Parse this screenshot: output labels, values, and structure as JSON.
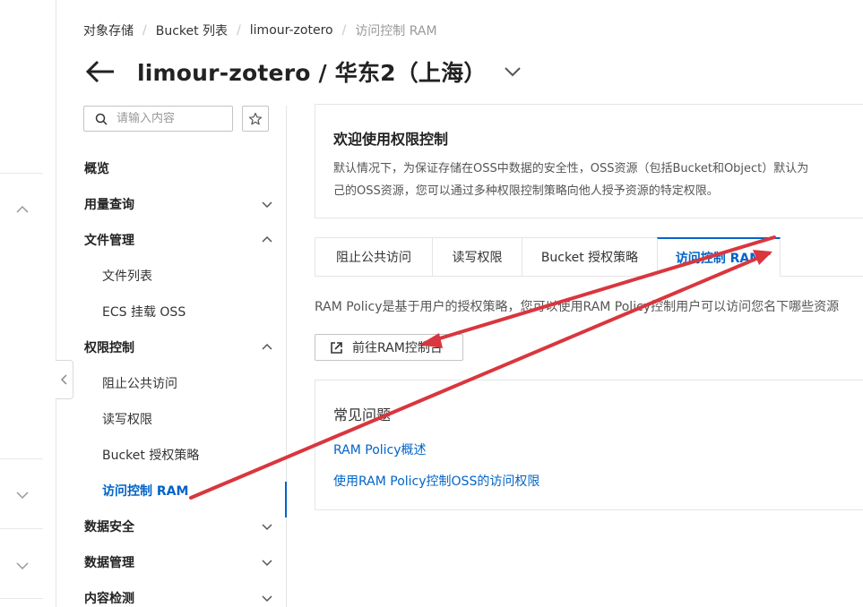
{
  "breadcrumb": {
    "items": [
      "对象存储",
      "Bucket 列表",
      "limour-zotero"
    ],
    "current": "访问控制 RAM"
  },
  "header": {
    "title": "limour-zotero / 华东2（上海）"
  },
  "sidebar": {
    "search_placeholder": "请输入内容",
    "items": [
      {
        "label": "概览"
      },
      {
        "label": "用量查询"
      },
      {
        "label": "文件管理"
      },
      {
        "label": "文件列表"
      },
      {
        "label": "ECS 挂载 OSS"
      },
      {
        "label": "权限控制"
      },
      {
        "label": "阻止公共访问"
      },
      {
        "label": "读写权限"
      },
      {
        "label": "Bucket 授权策略"
      },
      {
        "label": "访问控制 RAM"
      },
      {
        "label": "数据安全"
      },
      {
        "label": "数据管理"
      },
      {
        "label": "内容检测"
      }
    ]
  },
  "welcome": {
    "title": "欢迎使用权限控制",
    "line1": "默认情况下，为保证存储在OSS中数据的安全性，OSS资源（包括Bucket和Object）默认为",
    "line2": "己的OSS资源，您可以通过多种权限控制策略向他人授予资源的特定权限。"
  },
  "tabs": [
    {
      "label": "阻止公共访问"
    },
    {
      "label": "读写权限"
    },
    {
      "label": "Bucket 授权策略"
    },
    {
      "label": "访问控制 RAM"
    }
  ],
  "description": "RAM Policy是基于用户的授权策略，您可以使用RAM Policy控制用户可以访问您名下哪些资源",
  "ram_button": "前往RAM控制台",
  "faq": {
    "title": "常见问题",
    "links": [
      "RAM Policy概述",
      "使用RAM Policy控制OSS的访问权限"
    ]
  },
  "colors": {
    "accent": "#0064c8",
    "annotation": "#d9363e"
  }
}
